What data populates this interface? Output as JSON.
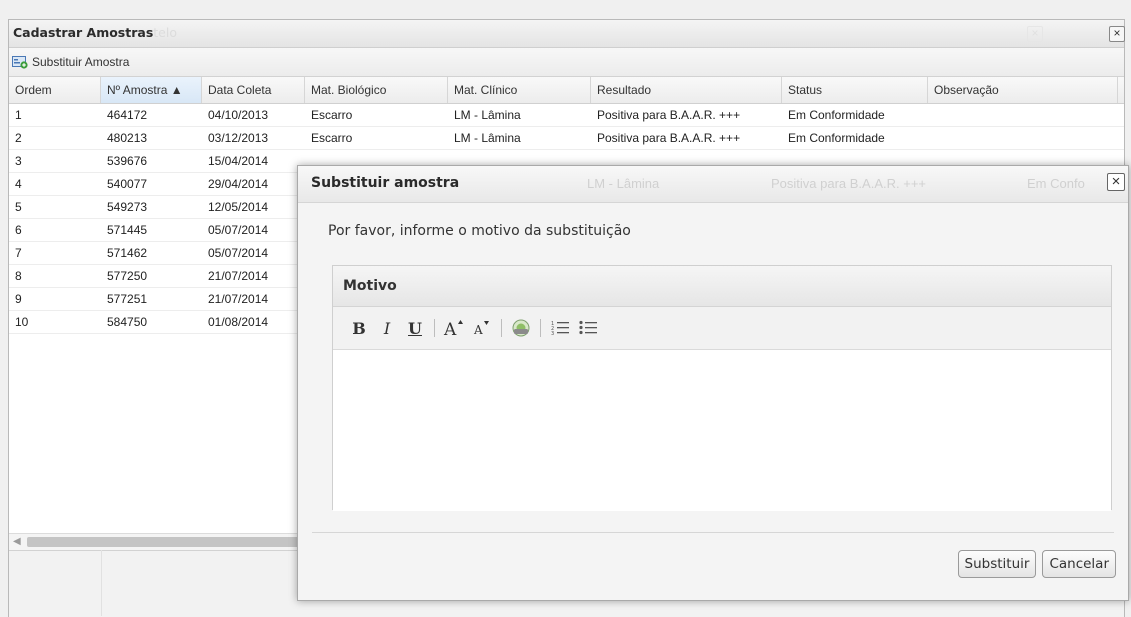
{
  "window": {
    "title": "Cadastrar Amostras",
    "title_ghost": "telo",
    "toolbar": {
      "substituir_label": "Substituir Amostra"
    }
  },
  "grid": {
    "columns": [
      "Ordem",
      "Nº Amostra ▲",
      "Data Coleta",
      "Mat. Biológico",
      "Mat. Clínico",
      "Resultado",
      "Status",
      "Observação"
    ],
    "rows": [
      [
        "1",
        "464172",
        "04/10/2013",
        "Escarro",
        "LM - Lâmina",
        "Positiva para B.A.A.R. +++",
        "Em Conformidade",
        ""
      ],
      [
        "2",
        "480213",
        "03/12/2013",
        "Escarro",
        "LM - Lâmina",
        "Positiva para B.A.A.R. +++",
        "Em Conformidade",
        ""
      ],
      [
        "3",
        "539676",
        "15/04/2014",
        "",
        "",
        "",
        "",
        ""
      ],
      [
        "4",
        "540077",
        "29/04/2014",
        "",
        "",
        "",
        "",
        ""
      ],
      [
        "5",
        "549273",
        "12/05/2014",
        "",
        "",
        "",
        "",
        ""
      ],
      [
        "6",
        "571445",
        "05/07/2014",
        "",
        "",
        "",
        "",
        ""
      ],
      [
        "7",
        "571462",
        "05/07/2014",
        "",
        "",
        "",
        "",
        ""
      ],
      [
        "8",
        "577250",
        "21/07/2014",
        "",
        "",
        "",
        "",
        ""
      ],
      [
        "9",
        "577251",
        "21/07/2014",
        "",
        "",
        "",
        "",
        ""
      ],
      [
        "10",
        "584750",
        "01/08/2014",
        "",
        "",
        "",
        "",
        ""
      ]
    ]
  },
  "modal": {
    "title": "Substituir amostra",
    "ghost_texts": [
      "LM - Lâmina",
      "Positiva para B.A.A.R. +++",
      "Em Confo"
    ],
    "prompt": "Por favor, informe o motivo da substituição",
    "editor": {
      "label": "Motivo",
      "tools": {
        "bold": "B",
        "italic": "I",
        "underline": "U",
        "font_bigger": "A˄",
        "font_smaller": "A˅"
      }
    },
    "buttons": {
      "substituir": "Substituir",
      "cancelar": "Cancelar"
    }
  },
  "colors": {
    "sorted_header": "#dde9f5",
    "window_border": "#b9b9b9"
  }
}
